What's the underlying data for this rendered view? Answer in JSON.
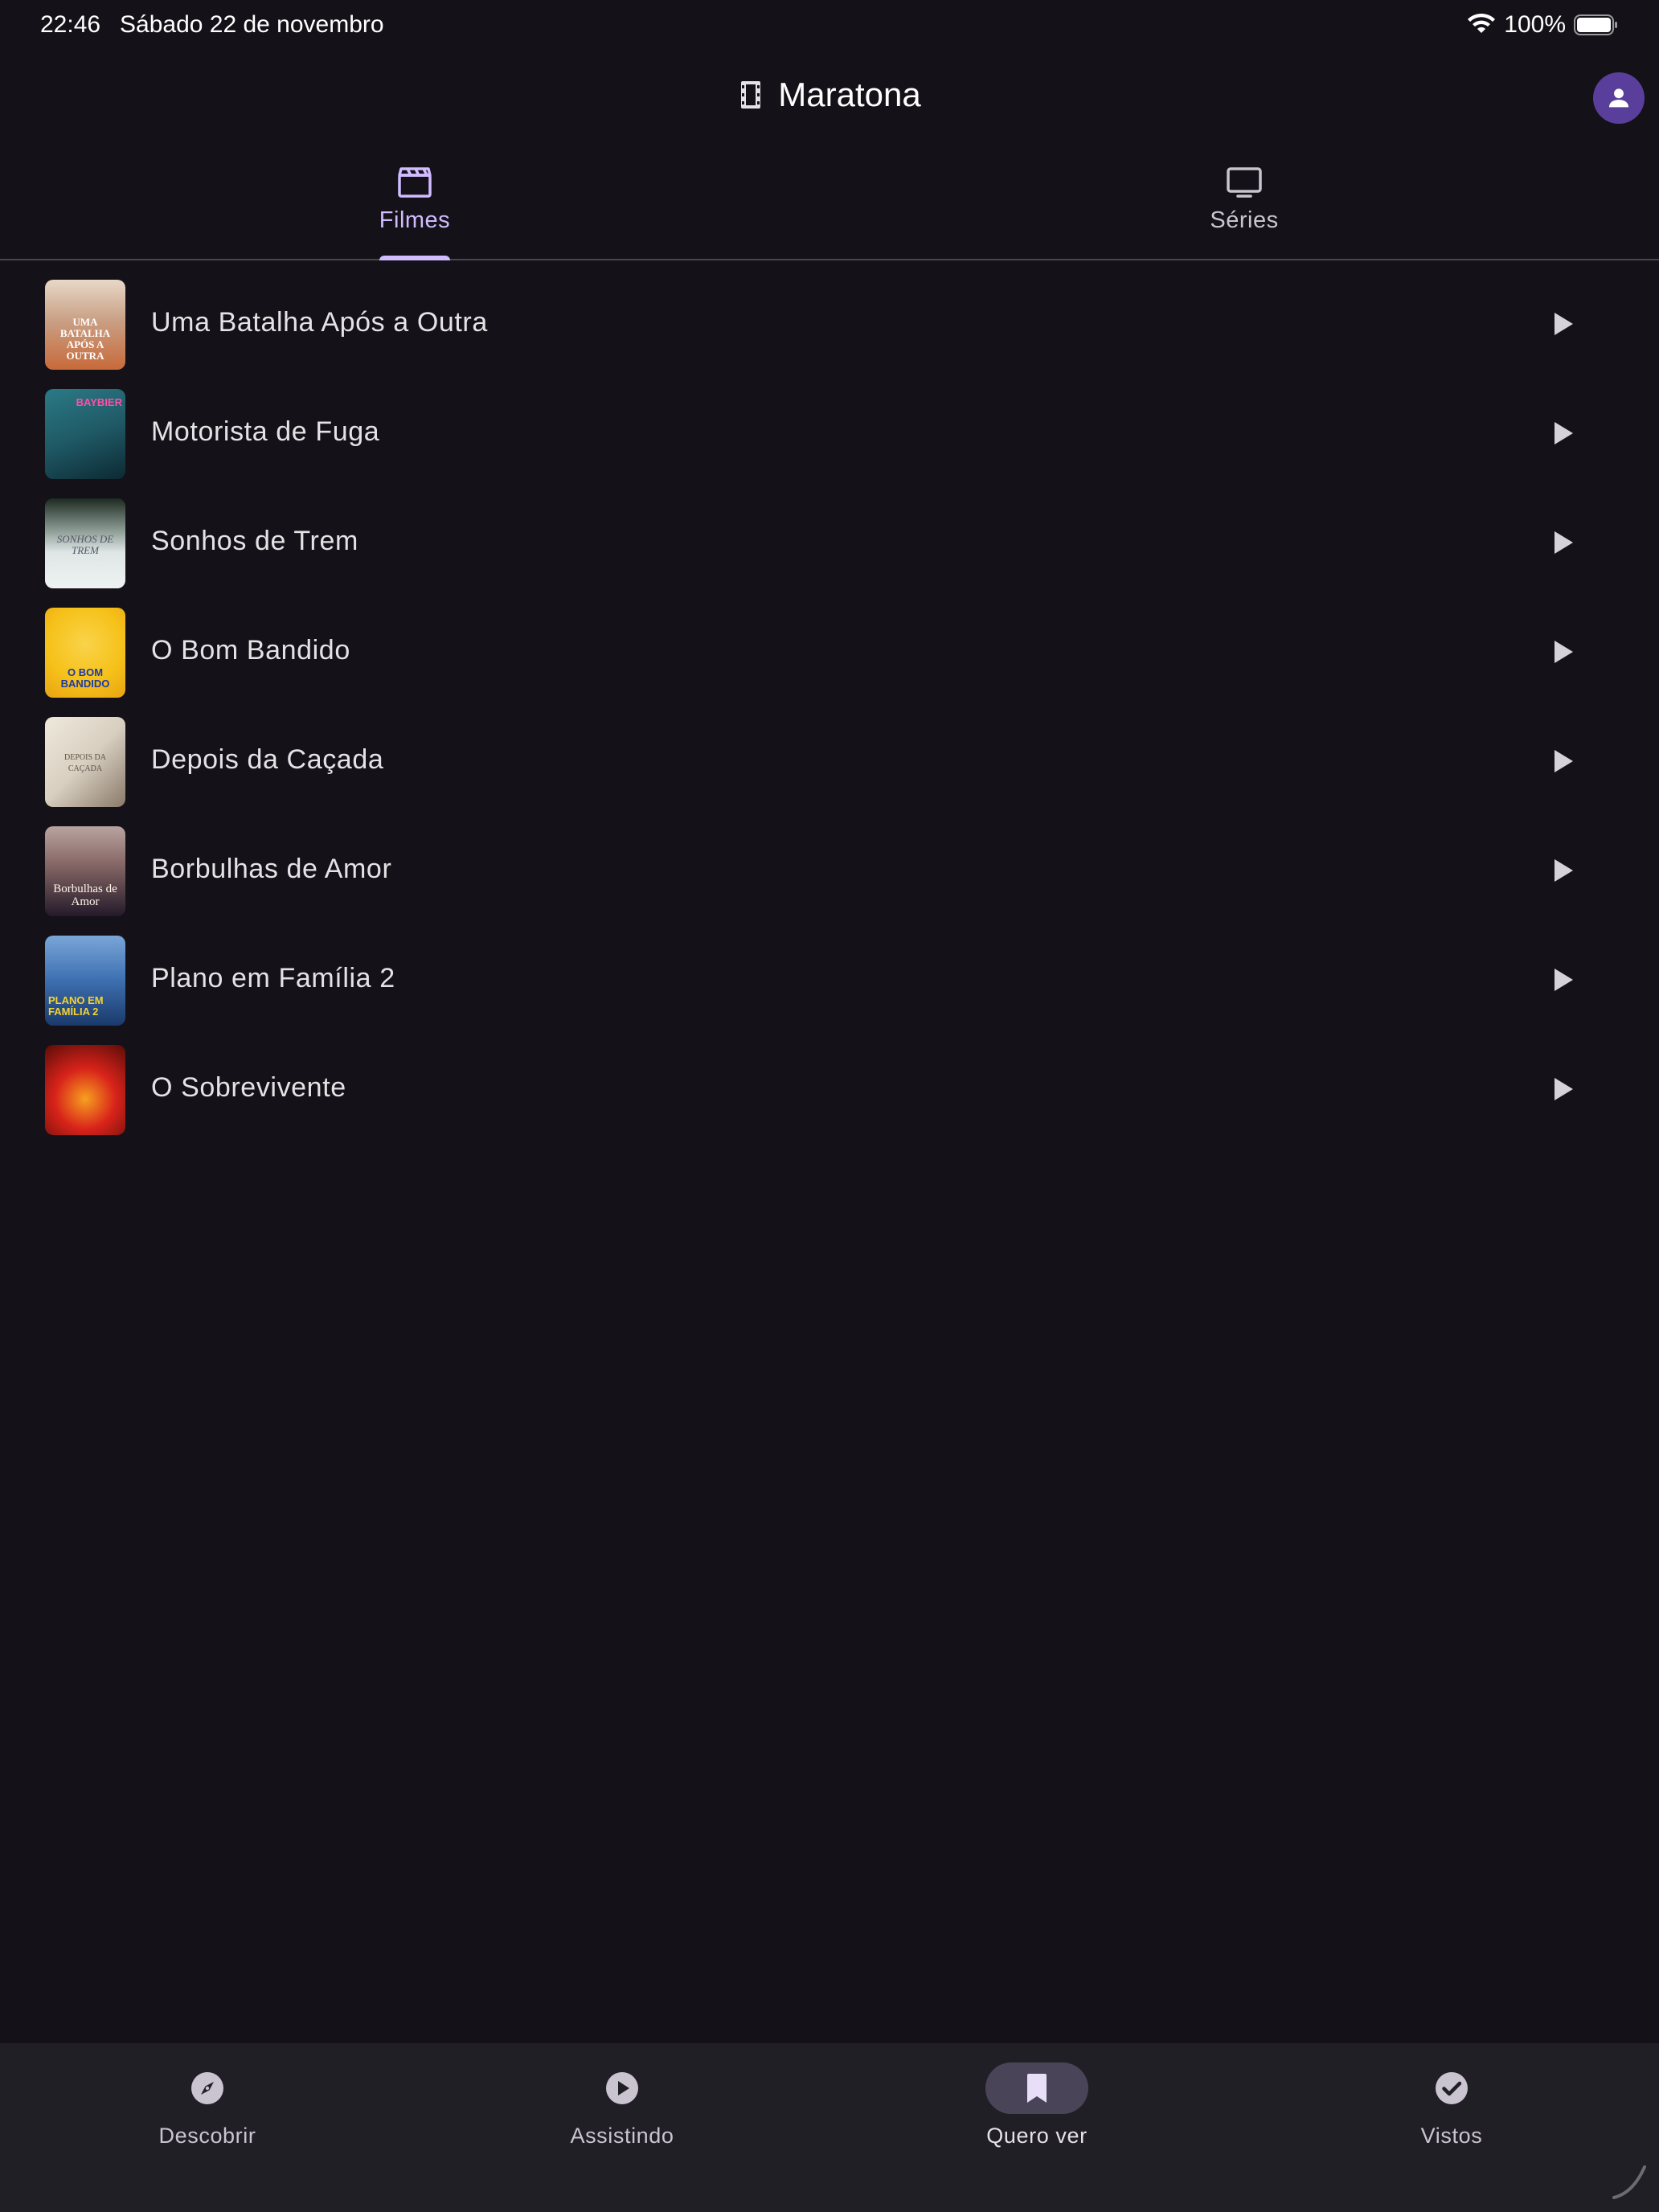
{
  "status_bar": {
    "time": "22:46",
    "date": "Sábado 22 de novembro",
    "battery": "100%"
  },
  "app_bar": {
    "title": "Maratona",
    "title_icon": "film-icon",
    "account_icon": "person-icon"
  },
  "tabs": [
    {
      "label": "Filmes",
      "icon": "clapperboard-icon",
      "active": true
    },
    {
      "label": "Séries",
      "icon": "tv-icon",
      "active": false
    }
  ],
  "movies": [
    {
      "title": "Uma Batalha Após a Outra",
      "poster_text": "UMA BATALHA APÓS A OUTRA",
      "poster_colors": [
        "#e8d8c8",
        "#c86a3a"
      ]
    },
    {
      "title": "Motorista de Fuga",
      "poster_text": "BAYBIER",
      "poster_colors": [
        "#1f5a66",
        "#0d2a33"
      ]
    },
    {
      "title": "Sonhos de Trem",
      "poster_text": "SONHOS DE TREM",
      "poster_colors": [
        "#1d2a22",
        "#dfe6e6"
      ]
    },
    {
      "title": "O Bom Bandido",
      "poster_text": "O BOM BANDIDO",
      "poster_colors": [
        "#f6c21a",
        "#e8a412"
      ]
    },
    {
      "title": "Depois da Caçada",
      "poster_text": "DEPOIS DA CAÇADA",
      "poster_colors": [
        "#efe9dc",
        "#8a7a6a"
      ]
    },
    {
      "title": "Borbulhas de Amor",
      "poster_text": "Borbulhas de Amor",
      "poster_colors": [
        "#8a6a68",
        "#241a2a"
      ]
    },
    {
      "title": "Plano em Família 2",
      "poster_text": "PLANO EM FAMÍLIA 2",
      "poster_colors": [
        "#3d6fb0",
        "#1a3a6a"
      ]
    },
    {
      "title": "O Sobrevivente",
      "poster_text": "",
      "poster_colors": [
        "#d8231a",
        "#5a0c08"
      ]
    }
  ],
  "bottom_nav": [
    {
      "label": "Descobrir",
      "icon": "compass-icon",
      "active": false
    },
    {
      "label": "Assistindo",
      "icon": "play-circle-icon",
      "active": false
    },
    {
      "label": "Quero ver",
      "icon": "bookmark-icon",
      "active": true
    },
    {
      "label": "Vistos",
      "icon": "check-circle-icon",
      "active": false
    }
  ],
  "colors": {
    "background": "#141218",
    "accent": "#d0bcff",
    "nav_background": "#211f26",
    "avatar": "#5a3e9b"
  }
}
